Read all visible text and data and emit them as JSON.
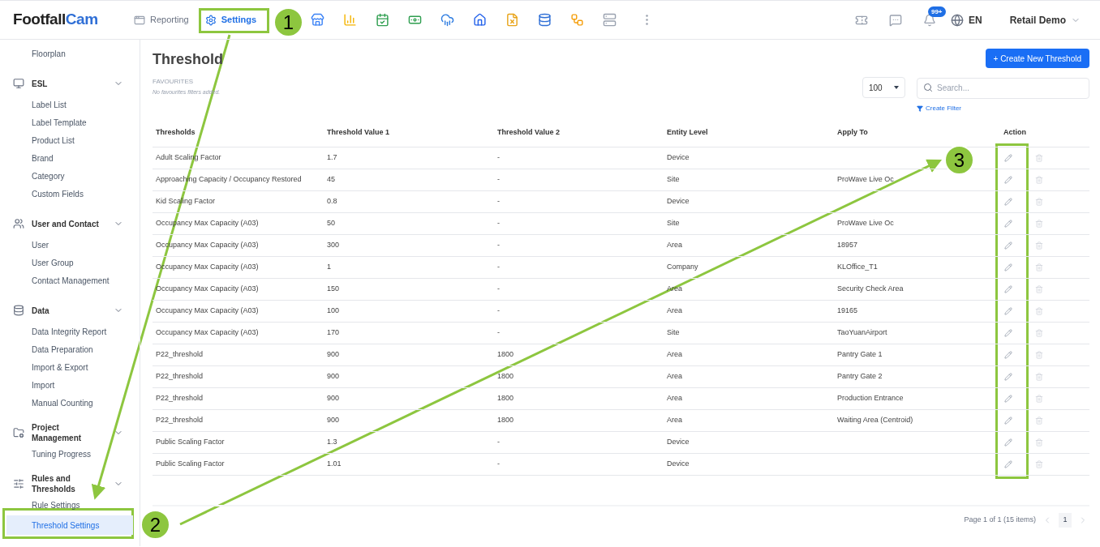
{
  "header": {
    "logo_dark": "Footfall",
    "logo_accent": "Cam",
    "nav": [
      {
        "kind": "text",
        "label": "Reporting",
        "selected": false
      },
      {
        "kind": "text",
        "label": "Settings",
        "selected": true
      },
      {
        "kind": "icon",
        "selected": false
      },
      {
        "kind": "icon",
        "selected": false
      },
      {
        "kind": "icon",
        "selected": false
      },
      {
        "kind": "icon",
        "selected": false
      },
      {
        "kind": "icon",
        "selected": false
      },
      {
        "kind": "icon",
        "selected": false
      },
      {
        "kind": "icon",
        "selected": false
      },
      {
        "kind": "icon",
        "selected": false
      },
      {
        "kind": "icon",
        "selected": false
      },
      {
        "kind": "icon",
        "selected": false
      },
      {
        "kind": "icon",
        "selected": false
      }
    ],
    "notification_badge": "99+",
    "language": "EN",
    "account": "Retail Demo"
  },
  "sidebar": {
    "items": [
      {
        "kind": "item",
        "label": "Floorplan",
        "selected": false
      },
      {
        "kind": "group",
        "label": "ESL",
        "expanded": true,
        "children": [
          {
            "label": "Label List",
            "selected": false
          },
          {
            "label": "Label Template",
            "selected": false
          },
          {
            "label": "Product List",
            "selected": false
          },
          {
            "label": "Brand",
            "selected": false
          },
          {
            "label": "Category",
            "selected": false
          },
          {
            "label": "Custom Fields",
            "selected": false
          }
        ]
      },
      {
        "kind": "group",
        "label": "User and Contact",
        "expanded": true,
        "children": [
          {
            "label": "User",
            "selected": false
          },
          {
            "label": "User Group",
            "selected": false
          },
          {
            "label": "Contact Management",
            "selected": false
          }
        ]
      },
      {
        "kind": "group",
        "label": "Data",
        "expanded": true,
        "children": [
          {
            "label": "Data Integrity Report",
            "selected": false
          },
          {
            "label": "Data Preparation",
            "selected": false
          },
          {
            "label": "Import & Export",
            "selected": false
          },
          {
            "label": "Import",
            "selected": false
          },
          {
            "label": "Manual Counting",
            "selected": false
          }
        ]
      },
      {
        "kind": "group",
        "label": "Project Management",
        "expanded": true,
        "children": [
          {
            "label": "Tuning Progress",
            "selected": false
          }
        ]
      },
      {
        "kind": "group",
        "label": "Rules and Thresholds",
        "expanded": true,
        "children": [
          {
            "label": "Rule Settings",
            "selected": false
          },
          {
            "label": "Threshold Settings",
            "selected": true
          }
        ]
      }
    ]
  },
  "page": {
    "title": "Threshold",
    "create_button": "+ Create New Threshold",
    "favourites_label": "FAVOURITES",
    "favourites_empty": "No favourites filters added.",
    "page_size": "100",
    "search": {
      "placeholder": "Search..."
    },
    "create_filter": "Create Filter"
  },
  "table": {
    "columns": [
      "Thresholds",
      "Threshold Value 1",
      "Threshold Value 2",
      "Entity Level",
      "Apply To",
      "Action"
    ],
    "rows": [
      [
        "Adult Scaling Factor",
        "1.7",
        "-",
        "Device",
        ""
      ],
      [
        "Approaching Capacity / Occupancy Restored",
        "45",
        "-",
        "Site",
        "ProWave Live Oc"
      ],
      [
        "Kid Scaling Factor",
        "0.8",
        "-",
        "Device",
        ""
      ],
      [
        "Occupancy Max Capacity (A03)",
        "50",
        "-",
        "Site",
        "ProWave Live Oc"
      ],
      [
        "Occupancy Max Capacity (A03)",
        "300",
        "-",
        "Area",
        "18957"
      ],
      [
        "Occupancy Max Capacity (A03)",
        "1",
        "-",
        "Company",
        "KLOffice_T1"
      ],
      [
        "Occupancy Max Capacity (A03)",
        "150",
        "-",
        "Area",
        "Security Check Area"
      ],
      [
        "Occupancy Max Capacity (A03)",
        "100",
        "-",
        "Area",
        "19165"
      ],
      [
        "Occupancy Max Capacity (A03)",
        "170",
        "-",
        "Site",
        "TaoYuanAirport"
      ],
      [
        "P22_threshold",
        "900",
        "1800",
        "Area",
        "Pantry Gate 1"
      ],
      [
        "P22_threshold",
        "900",
        "1800",
        "Area",
        "Pantry Gate 2"
      ],
      [
        "P22_threshold",
        "900",
        "1800",
        "Area",
        "Production Entrance"
      ],
      [
        "P22_threshold",
        "900",
        "1800",
        "Area",
        "Waiting Area (Centroid)"
      ],
      [
        "Public Scaling Factor",
        "1.3",
        "-",
        "Device",
        ""
      ],
      [
        "Public Scaling Factor",
        "1.01",
        "-",
        "Device",
        ""
      ]
    ]
  },
  "pagination": {
    "summary": "Page 1 of 1 (15 items)",
    "pages": [
      {
        "label": "1",
        "selected": true
      }
    ]
  },
  "annotations": [
    "1",
    "2",
    "3"
  ]
}
